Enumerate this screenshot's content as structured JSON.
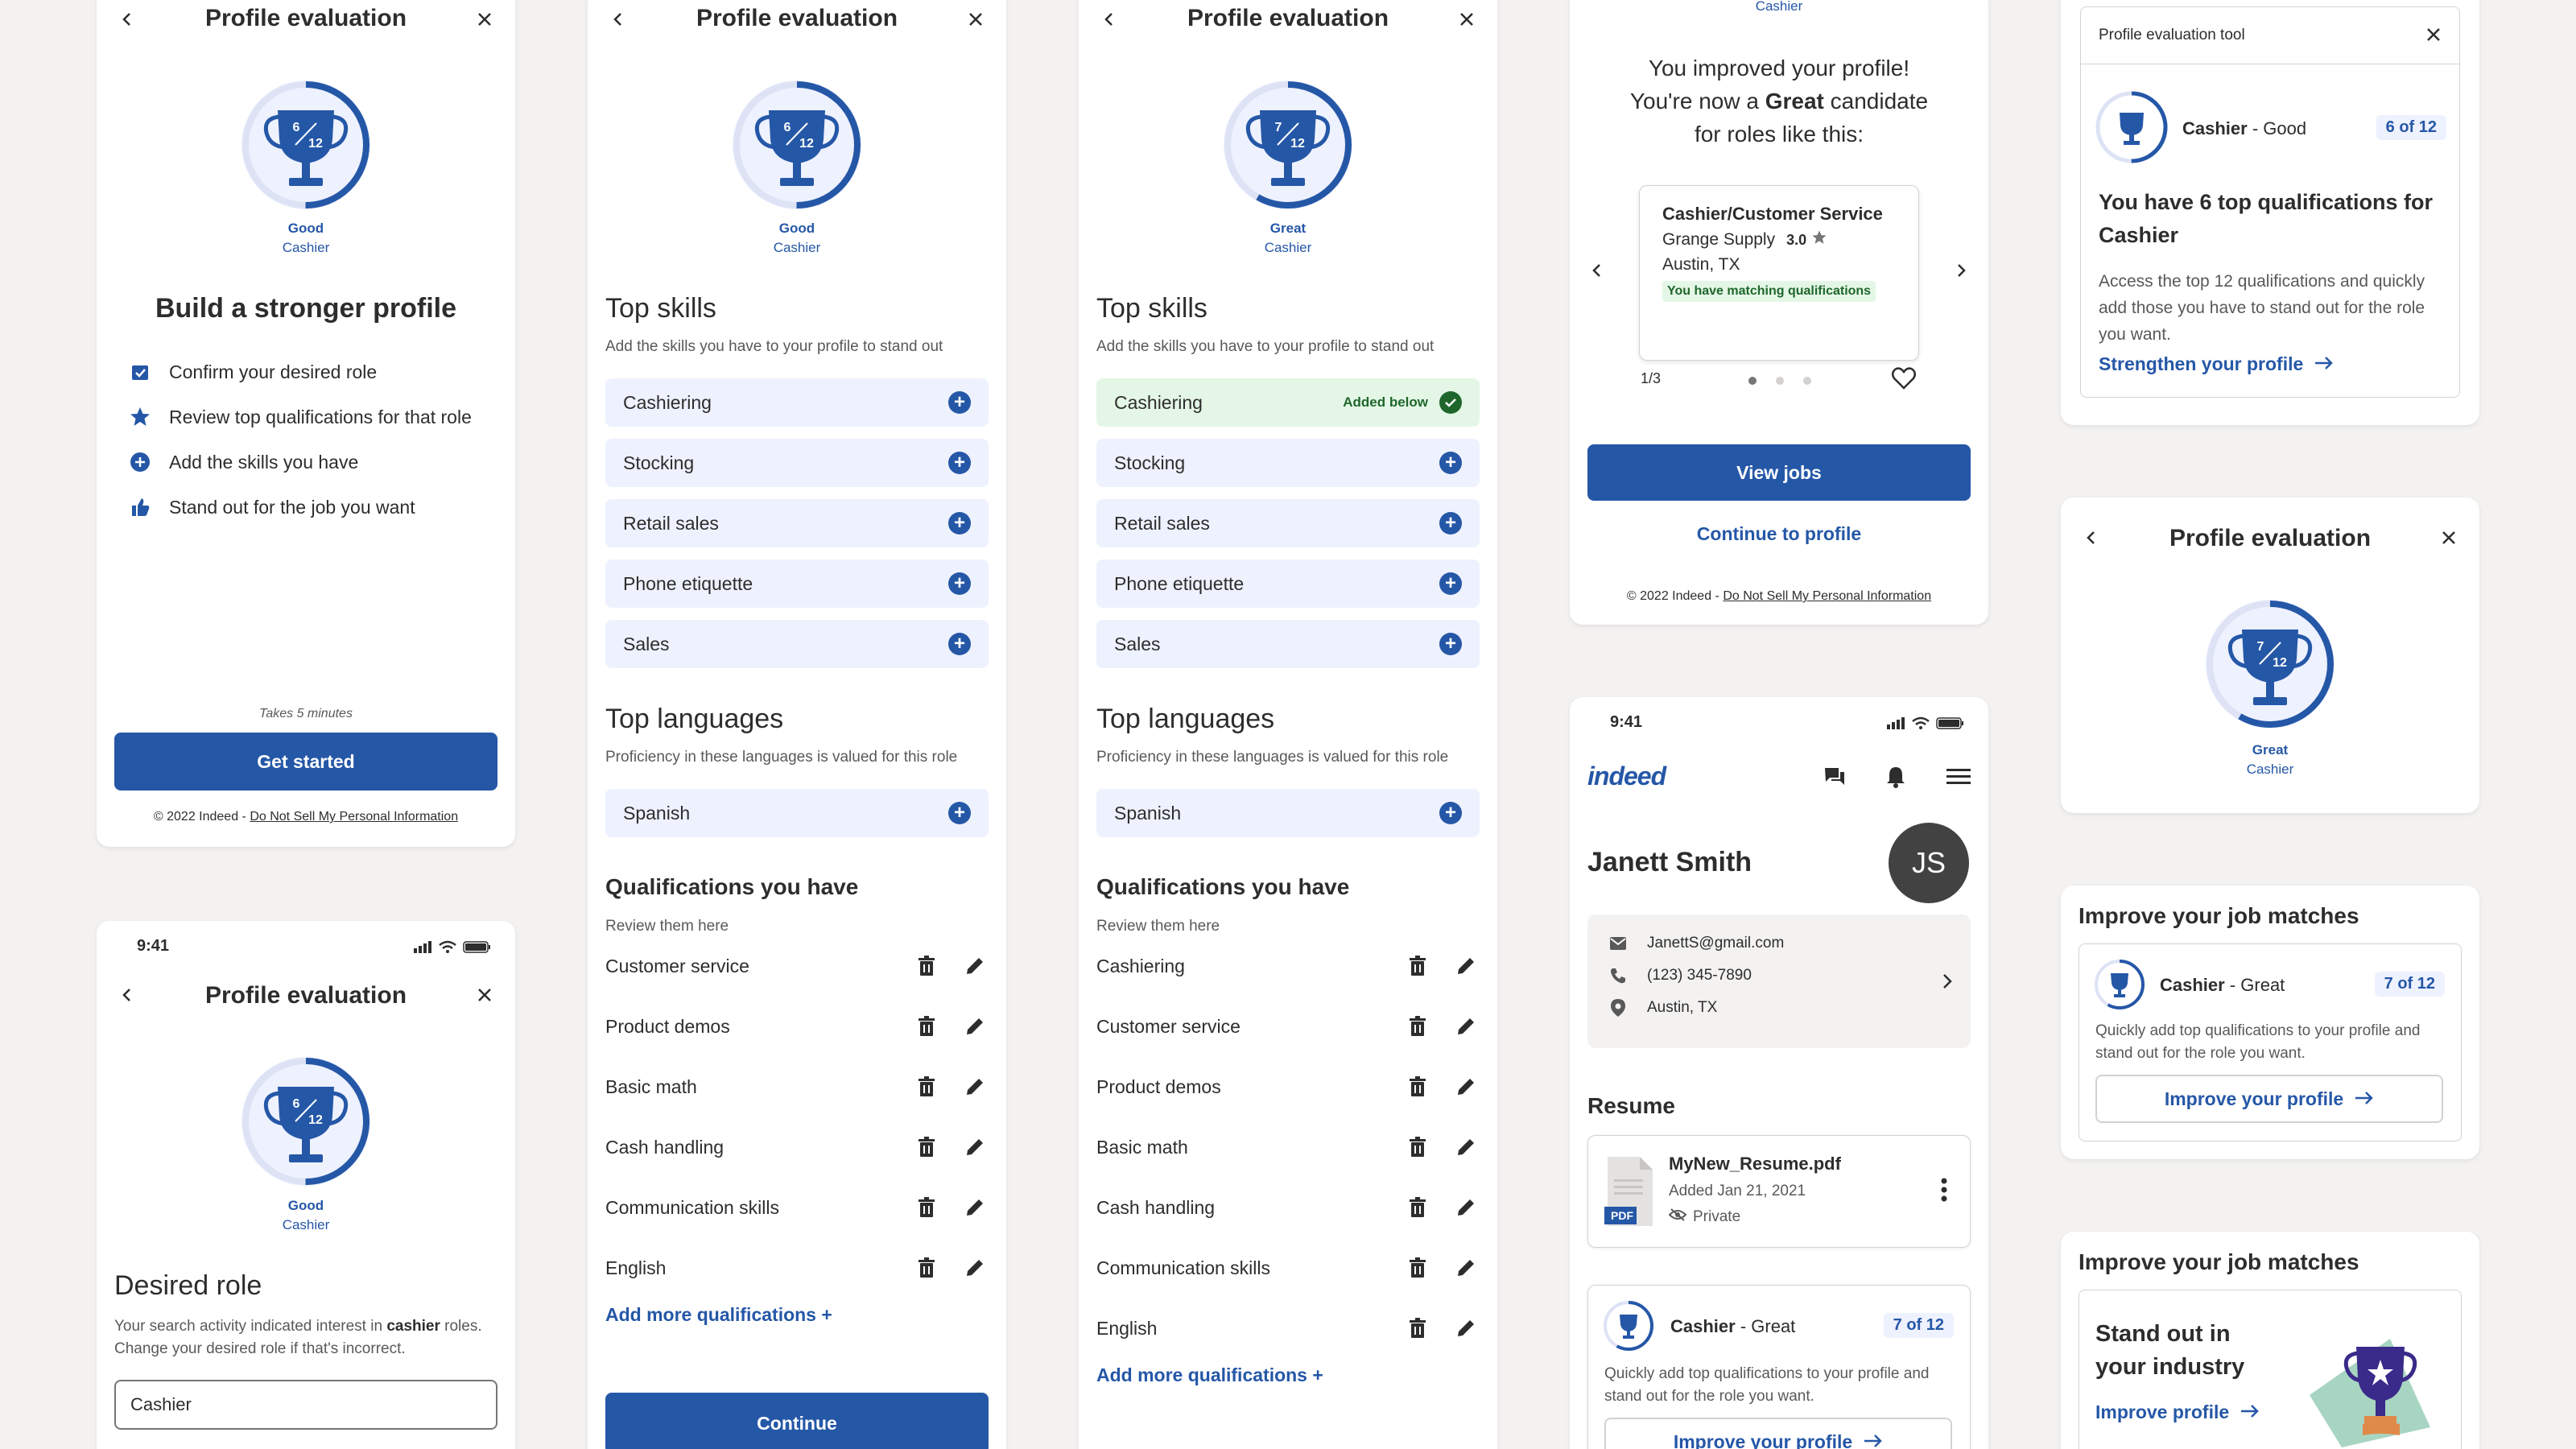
{
  "c1": {
    "title": "Profile evaluation",
    "trophy_fraction": "6/12",
    "level": "Good",
    "role": "Cashier",
    "heading": "Build a stronger profile",
    "steps": [
      "Confirm your desired role",
      "Review top qualifications for that role",
      "Add the skills you have",
      "Stand out for the job you want"
    ],
    "time_note": "Takes 5 minutes",
    "cta": "Get started",
    "footer_copy": "© 2022 Indeed - ",
    "footer_link": "Do Not Sell My Personal Information"
  },
  "c2": {
    "time": "9:41",
    "title": "Profile evaluation",
    "trophy_fraction": "6/12",
    "level": "Good",
    "role": "Cashier",
    "heading": "Desired role",
    "desc_1": "Your search activity indicated interest in ",
    "desc_bold": "cashier",
    "desc_2": " roles. Change your desired role if that's incorrect.",
    "input_value": "Cashier"
  },
  "c3": {
    "title": "Profile evaluation",
    "trophy_fraction": "6/12",
    "level": "Good",
    "role": "Cashier",
    "skills_title": "Top skills",
    "skills_sub": "Add the skills you have to your profile to stand out",
    "skills": [
      "Cashiering",
      "Stocking",
      "Retail sales",
      "Phone etiquette",
      "Sales"
    ],
    "lang_title": "Top languages",
    "lang_sub": "Proficiency in these languages is valued for this role",
    "languages": [
      "Spanish"
    ],
    "quals_title": "Qualifications you have",
    "quals_sub": "Review them here",
    "quals": [
      "Customer service",
      "Product demos",
      "Basic math",
      "Cash handling",
      "Communication skills",
      "English"
    ],
    "add_more": "Add more qualifications +",
    "cta": "Continue"
  },
  "c4": {
    "title": "Profile evaluation",
    "trophy_fraction": "7/12",
    "level": "Great",
    "role": "Cashier",
    "skills_title": "Top skills",
    "skills_sub": "Add the skills you have to your profile to stand out",
    "skills": [
      "Cashiering",
      "Stocking",
      "Retail sales",
      "Phone etiquette",
      "Sales"
    ],
    "added_label": "Added below",
    "lang_title": "Top languages",
    "lang_sub": "Proficiency in these languages is valued for this role",
    "languages": [
      "Spanish"
    ],
    "quals_title": "Qualifications you have",
    "quals_sub": "Review them here",
    "quals": [
      "Cashiering",
      "Customer service",
      "Product demos",
      "Basic math",
      "Cash handling",
      "Communication skills",
      "English"
    ],
    "add_more": "Add more qualifications +"
  },
  "c5": {
    "top_role": "Cashier",
    "msg_1": "You improved your profile!",
    "msg_2a": "You're now a ",
    "msg_2b": "Great",
    "msg_2c": " candidate",
    "msg_3": "for roles like this:",
    "job_title": "Cashier/Customer Service",
    "company": "Grange Supply",
    "rating": "3.0",
    "location": "Austin, TX",
    "match_badge": "You have matching qualifications",
    "pager": "1/3",
    "cta": "View jobs",
    "secondary": "Continue to profile",
    "footer_copy": "© 2022 Indeed - ",
    "footer_link": "Do Not Sell My Personal Information"
  },
  "c6": {
    "time": "9:41",
    "logo": "indeed",
    "name": "Janett Smith",
    "initials": "JS",
    "email": "JanettS@gmail.com",
    "phone": "(123) 345-7890",
    "location": "Austin, TX",
    "resume_title": "Resume",
    "file_name": "MyNew_Resume.pdf",
    "file_date": "Added Jan 21, 2021",
    "file_privacy": "Private",
    "file_type": "PDF",
    "eval_role": "Cashier",
    "eval_level": " - Great",
    "eval_count": "7 of 12",
    "eval_desc": "Quickly add top qualifications to your profile and stand out for the role you want.",
    "eval_cta": "Improve your profile"
  },
  "c7": {
    "header": "Profile evaluation tool",
    "role": "Cashier",
    "level": " - Good",
    "count": "6 of 12",
    "heading": "You have 6 top qualifications for Cashier",
    "desc": "Access the top 12 qualifications and quickly add those you have to stand out for the role you want.",
    "cta": "Strengthen your profile"
  },
  "c8": {
    "title": "Profile evaluation",
    "trophy_fraction": "7/12",
    "level": "Great",
    "role": "Cashier"
  },
  "c9": {
    "title": "Improve your job matches",
    "role": "Cashier",
    "level": " - Great",
    "count": "7 of 12",
    "desc": "Quickly add top qualifications to your profile and stand out for the role you want.",
    "cta": "Improve your profile"
  },
  "c10": {
    "title": "Improve your job matches",
    "heading": "Stand out in your industry",
    "cta": "Improve profile"
  },
  "colors": {
    "primary": "#2557a7",
    "success": "#1f662c",
    "text": "#2d2d2d",
    "muted": "#595959"
  }
}
